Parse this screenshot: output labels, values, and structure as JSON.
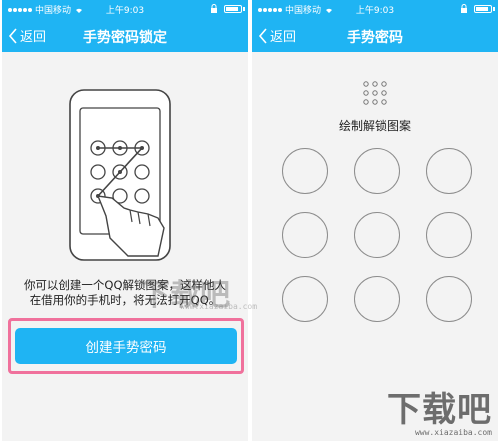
{
  "screens": [
    {
      "status": {
        "carrier": "中国移动",
        "time": "上午9:03"
      },
      "nav": {
        "back_label": "返回",
        "title": "手势密码锁定"
      },
      "description_line1": "你可以创建一个QQ解锁图案，这样他人",
      "description_line2": "在借用你的手机时，将无法打开QQ。",
      "button_label": "创建手势密码"
    },
    {
      "status": {
        "carrier": "中国移动",
        "time": "上午9:03"
      },
      "nav": {
        "back_label": "返回",
        "title": "手势密码"
      },
      "instruction": "绘制解锁图案"
    }
  ],
  "watermark": {
    "text": "下载吧",
    "url": "www.xiazaiba.com"
  },
  "colors": {
    "accent": "#1fb4f3",
    "highlight": "#f0719c",
    "background": "#f3f3f3"
  },
  "icons": [
    "signal-dots-icon",
    "wifi-icon",
    "lock-icon",
    "battery-icon",
    "back-chevron-icon",
    "phone-pattern-illustration",
    "pattern-preview-icon"
  ]
}
